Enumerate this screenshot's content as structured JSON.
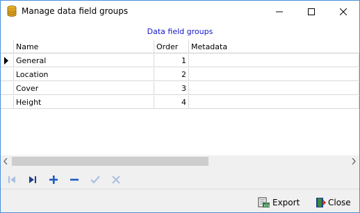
{
  "window": {
    "title": "Manage data field groups",
    "accent": "#2a6ebb"
  },
  "grid": {
    "caption": "Data field groups",
    "columns": [
      "Name",
      "Order",
      "Metadata"
    ],
    "rows": [
      {
        "name": "General",
        "order": "1",
        "metadata": ""
      },
      {
        "name": "Location",
        "order": "2",
        "metadata": ""
      },
      {
        "name": "Cover",
        "order": "3",
        "metadata": ""
      },
      {
        "name": "Height",
        "order": "4",
        "metadata": ""
      }
    ],
    "current_row": 0
  },
  "navigator": {
    "buttons": [
      "first-record-icon",
      "last-record-icon",
      "add-icon",
      "remove-icon",
      "confirm-icon",
      "cancel-icon"
    ]
  },
  "footer": {
    "export_label": "Export",
    "close_label": "Close"
  }
}
